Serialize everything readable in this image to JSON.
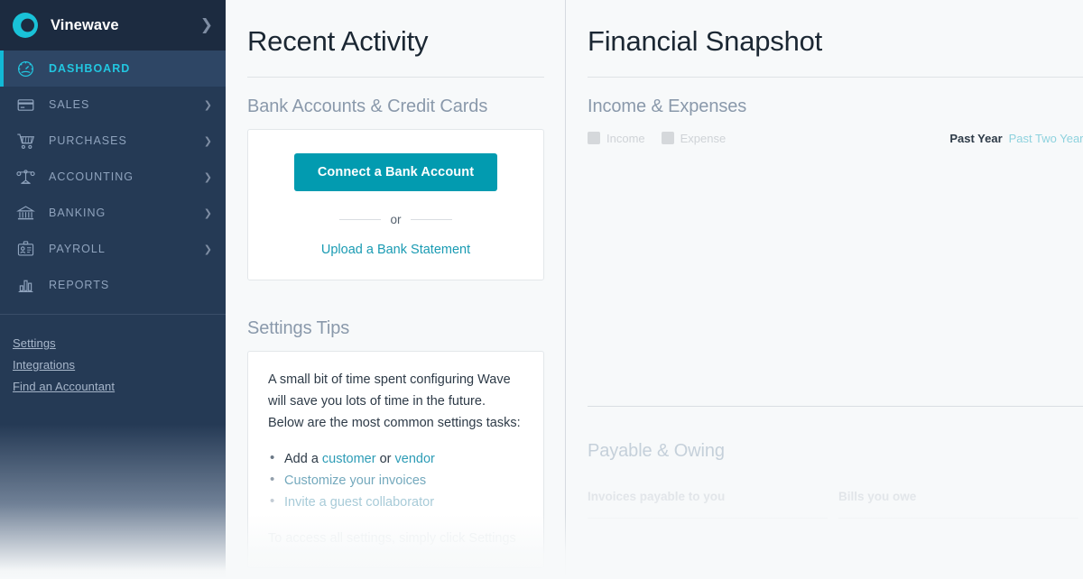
{
  "sidebar": {
    "brand": {
      "name": "Vinewave",
      "logo_icon": "wave-circle-logo",
      "collapse_icon": "chevron-right-icon"
    },
    "items": [
      {
        "label": "DASHBOARD",
        "icon": "gauge-icon",
        "active": true,
        "expandable": false
      },
      {
        "label": "SALES",
        "icon": "credit-card-icon",
        "active": false,
        "expandable": true
      },
      {
        "label": "PURCHASES",
        "icon": "shopping-cart-icon",
        "active": false,
        "expandable": true
      },
      {
        "label": "ACCOUNTING",
        "icon": "scales-icon",
        "active": false,
        "expandable": true
      },
      {
        "label": "BANKING",
        "icon": "bank-icon",
        "active": false,
        "expandable": true
      },
      {
        "label": "PAYROLL",
        "icon": "id-badge-icon",
        "active": false,
        "expandable": true
      },
      {
        "label": "REPORTS",
        "icon": "bar-chart-icon",
        "active": false,
        "expandable": false
      }
    ],
    "links": [
      {
        "label": "Settings"
      },
      {
        "label": "Integrations"
      },
      {
        "label": "Find an Accountant"
      }
    ]
  },
  "recent_activity": {
    "title": "Recent Activity",
    "bank_section": {
      "heading": "Bank Accounts & Credit Cards",
      "connect_button": "Connect a Bank Account",
      "or_text": "or",
      "upload_link": "Upload a Bank Statement"
    },
    "settings_tips": {
      "heading": "Settings Tips",
      "paragraph": "A small bit of time spent configuring Wave will save you lots of time in the future. Below are the most common settings tasks:",
      "items": [
        {
          "prefix": "Add a ",
          "link1": "customer",
          "middle": " or ",
          "link2": "vendor"
        },
        {
          "text": "Customize your invoices"
        },
        {
          "text": "Invite a guest collaborator"
        }
      ],
      "footer": "To access all settings, simply click Settings"
    }
  },
  "financial_snapshot": {
    "title": "Financial Snapshot",
    "income_expenses": {
      "heading": "Income & Expenses",
      "legend": [
        {
          "label": "Income",
          "color": "#d5d8db"
        },
        {
          "label": "Expense",
          "color": "#d5d8db"
        }
      ],
      "range_active": "Past Year",
      "range_other": "Past Two Years"
    },
    "payable_owing": {
      "heading": "Payable & Owing",
      "columns": [
        {
          "header": "Invoices payable to you"
        },
        {
          "header": "Bills you owe"
        }
      ]
    }
  },
  "colors": {
    "sidebar_bg": "#253a55",
    "sidebar_brand_bg": "#1c2b40",
    "accent_cyan": "#12b9d6",
    "primary_teal": "#029bb0",
    "link_teal": "#1a9bb3",
    "page_bg": "#f7f9fa"
  }
}
